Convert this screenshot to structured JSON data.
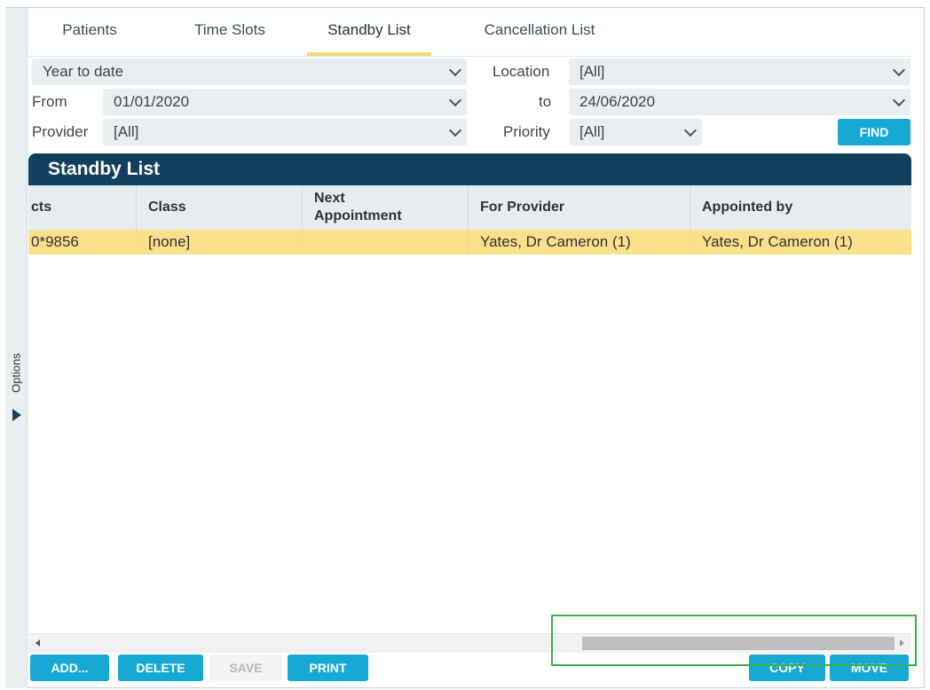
{
  "sidebar": {
    "options_label": "Options"
  },
  "tabs": [
    {
      "label": "Patients"
    },
    {
      "label": "Time Slots"
    },
    {
      "label": "Standby List"
    },
    {
      "label": "Cancellation List"
    }
  ],
  "filters": {
    "period_value": "Year to date",
    "location_label": "Location",
    "location_value": "[All]",
    "from_label": "From",
    "from_value": "01/01/2020",
    "to_label": "to",
    "to_value": "24/06/2020",
    "provider_label": "Provider",
    "provider_value": "[All]",
    "priority_label": "Priority",
    "priority_value": "[All]",
    "find_label": "FIND"
  },
  "panel": {
    "title": "Standby List"
  },
  "table": {
    "columns": [
      "cts",
      "Class",
      "Next\nAppointment",
      "For Provider",
      "Appointed by"
    ],
    "rows": [
      [
        "0*9856",
        "[none]",
        "",
        "Yates, Dr Cameron (1)",
        "Yates, Dr Cameron (1)"
      ]
    ]
  },
  "actions": {
    "add_label": "ADD...",
    "delete_label": "DELETE",
    "save_label": "SAVE",
    "print_label": "PRINT",
    "copy_label": "COPY",
    "move_label": "MOVE"
  },
  "colors": {
    "header_bg": "#133f5e",
    "accent": "#15a9d3",
    "selected_row": "#fbe08c",
    "active_tab_underline": "#f6d872"
  }
}
